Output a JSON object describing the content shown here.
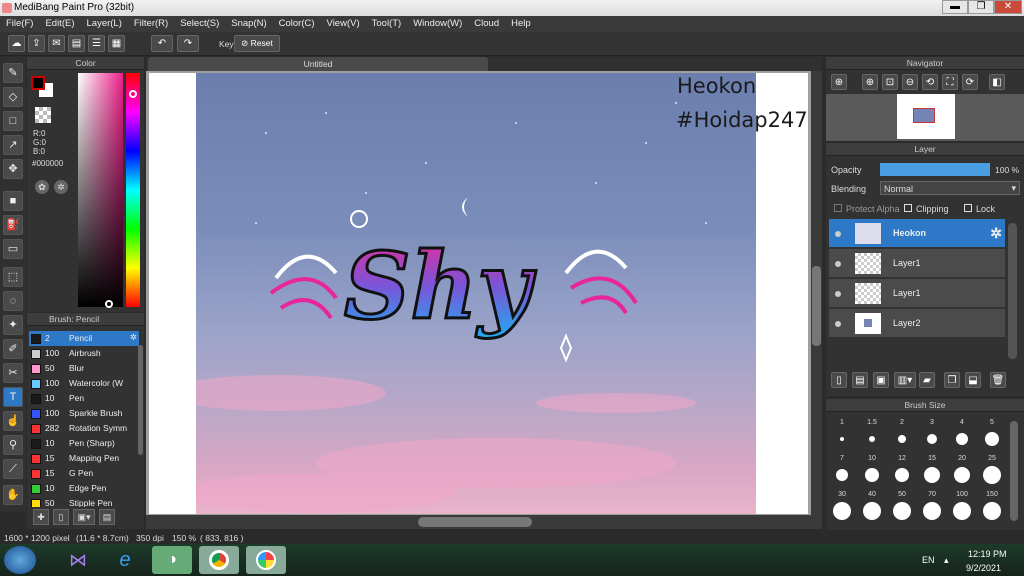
{
  "window": {
    "title": "MediBang Paint Pro (32bit)",
    "min": "▬",
    "max": "❐",
    "close": "✕"
  },
  "menu": [
    "File(F)",
    "Edit(E)",
    "Layer(L)",
    "Filter(R)",
    "Select(S)",
    "Snap(N)",
    "Color(C)",
    "View(V)",
    "Tool(T)",
    "Window(W)",
    "Cloud",
    "Help"
  ],
  "toolbar": {
    "key_label": "Key",
    "reset_label": "Reset"
  },
  "color_panel": {
    "title": "Color",
    "r": "R:0",
    "g": "G:0",
    "b": "B:0",
    "hex": "#000000",
    "fg": "#000000",
    "bg": "#ffffff",
    "accent": "#2e79c7"
  },
  "brush_panel": {
    "title": "Brush: Pencil",
    "items": [
      {
        "size": "2",
        "name": "Pencil",
        "color": "#1a1a1a"
      },
      {
        "size": "100",
        "name": "Airbrush",
        "color": "#cccccc"
      },
      {
        "size": "50",
        "name": "Blur",
        "color": "#ff99cc"
      },
      {
        "size": "100",
        "name": "Watercolor (W",
        "color": "#66ccff"
      },
      {
        "size": "10",
        "name": "Pen",
        "color": "#1a1a1a"
      },
      {
        "size": "100",
        "name": "Sparkle Brush",
        "color": "#3355ff"
      },
      {
        "size": "282",
        "name": "Rotation Symm",
        "color": "#ff3333"
      },
      {
        "size": "10",
        "name": "Pen (Sharp)",
        "color": "#1a1a1a"
      },
      {
        "size": "15",
        "name": "Mapping Pen",
        "color": "#ff3333"
      },
      {
        "size": "15",
        "name": "G Pen",
        "color": "#ff3333"
      },
      {
        "size": "10",
        "name": "Edge Pen",
        "color": "#33cc33"
      },
      {
        "size": "50",
        "name": "Stipple Pen",
        "color": "#ffdd00"
      }
    ]
  },
  "canvas": {
    "tab": "Untitled",
    "text1": "Heokon",
    "text2": "#Hoidap247",
    "artwork_word": "Shy"
  },
  "navigator": {
    "title": "Navigator"
  },
  "layer_panel": {
    "title": "Layer",
    "opacity_label": "Opacity",
    "opacity_value": "100 %",
    "opacity": 1.0,
    "blending_label": "Blending",
    "blending_value": "Normal",
    "protect_alpha": "Protect Alpha",
    "clipping": "Clipping",
    "lock": "Lock",
    "layers": [
      {
        "name": "Heokon",
        "selected": true
      },
      {
        "name": "Layer1",
        "selected": false
      },
      {
        "name": "Layer1",
        "selected": false
      },
      {
        "name": "Layer2",
        "selected": false
      }
    ]
  },
  "brush_size": {
    "title": "Brush Size",
    "sizes": [
      "1",
      "1.5",
      "2",
      "3",
      "4",
      "5",
      "7",
      "10",
      "12",
      "15",
      "20",
      "25",
      "30",
      "40",
      "50",
      "70",
      "100",
      "150"
    ]
  },
  "status": {
    "pixels": "1600 * 1200 pixel",
    "cm": "(11.6 * 8.7cm)",
    "dpi": "350 dpi",
    "zoom": "150 %",
    "coords": "( 833, 816 )"
  },
  "taskbar": {
    "lang": "EN",
    "time": "12:19 PM",
    "date": "9/2/2021"
  }
}
